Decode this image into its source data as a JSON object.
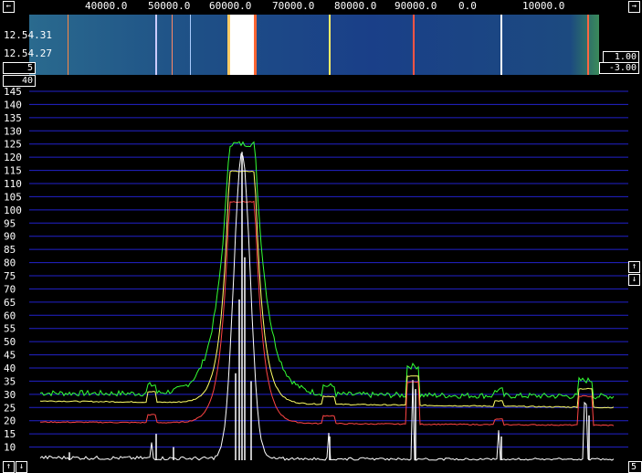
{
  "freq_axis": {
    "labels": [
      "40000.0",
      "50000.0",
      "60000.0",
      "70000.0",
      "80000.0",
      "90000.0",
      "0.0",
      "10000.0"
    ]
  },
  "waterfall": {
    "times": [
      "12.54.31",
      "12.54.27"
    ]
  },
  "controls": {
    "left_value": "5",
    "left_value2": "40",
    "right_top": "1.00",
    "right_bottom": "-3.00",
    "bottom_right": "5",
    "scroll_up": "↑",
    "scroll_down": "↓",
    "bottom_left_up": "↑",
    "bottom_left_down": "↓",
    "scroll_left": "←",
    "scroll_right": "→"
  },
  "chart_data": {
    "type": "line",
    "ylim": [
      5,
      150
    ],
    "yticks": [
      10,
      15,
      20,
      25,
      30,
      35,
      40,
      45,
      50,
      55,
      60,
      65,
      70,
      75,
      80,
      85,
      90,
      95,
      100,
      105,
      110,
      115,
      120,
      125,
      130,
      135,
      140,
      145
    ],
    "colors": {
      "green": "#33ff33",
      "yellow": "#ffff66",
      "red": "#ff4444",
      "white": "#ffffff",
      "grid": "#2222cc"
    }
  }
}
